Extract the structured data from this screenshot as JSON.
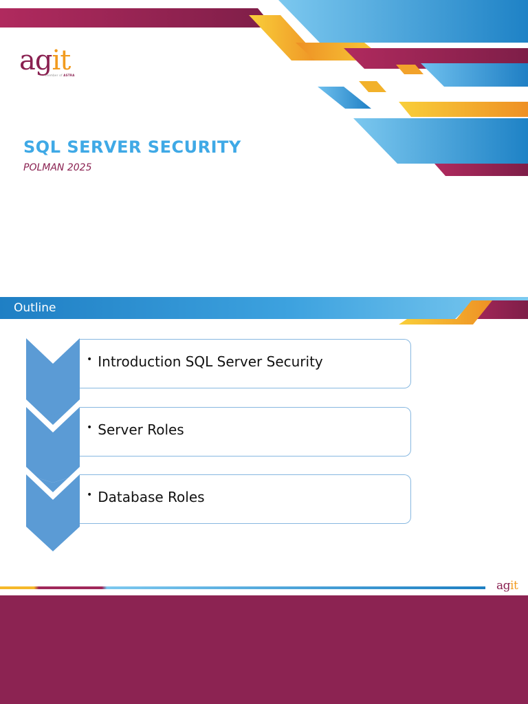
{
  "colors": {
    "brand_maroon": "#8c2352",
    "brand_blue": "#1e88d0",
    "brand_orange": "#f29b1e",
    "title_blue": "#3fa9e6"
  },
  "slide1": {
    "logo": {
      "main_ag": "ag",
      "main_it": "it",
      "tag_prefix": "member of ",
      "tag_brand": "ASTRA"
    },
    "title": "SQL SERVER SECURITY",
    "subtitle": "POLMAN 2025"
  },
  "slide2": {
    "header": "Outline",
    "items": [
      {
        "label": "Introduction SQL Server Security"
      },
      {
        "label": "Server Roles"
      },
      {
        "label": "Database Roles"
      }
    ],
    "bullet": "•",
    "footer_logo": {
      "ag": "ag",
      "it": "it"
    }
  }
}
